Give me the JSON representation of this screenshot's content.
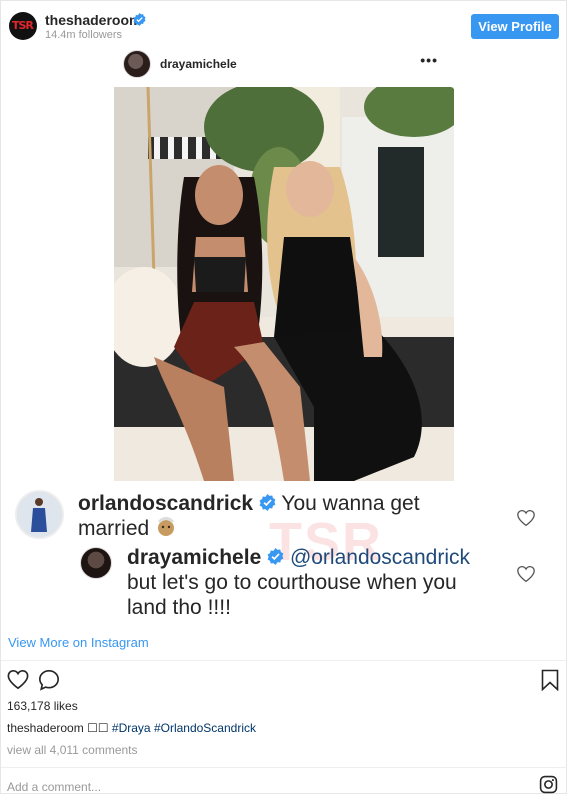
{
  "header": {
    "username": "theshaderoom",
    "followers": "14.4m followers",
    "avatar_text": "TSR",
    "view_profile_label": "View Profile"
  },
  "embed": {
    "username": "drayamichele",
    "more_icon": "more-dots-icon",
    "more_label": "•••"
  },
  "comments": [
    {
      "user": "orlandoscandrick",
      "text_line1": "You wanna get",
      "text_line2": "married"
    },
    {
      "user": "drayamichele",
      "mention": "@orlandoscandrick",
      "text_line1": "but let's go to courthouse when you",
      "text_line2": "land tho !!!!"
    }
  ],
  "watermark": "TSR",
  "view_more_label": "View More on Instagram",
  "likes": "163,178 likes",
  "caption": {
    "user": "theshaderoom",
    "emoji": "☐☐",
    "tags": "#Draya #OrlandoScandrick"
  },
  "view_all_comments": "view all 4,011 comments",
  "add_comment_placeholder": "Add a comment...",
  "colors": {
    "accent": "#3897f0",
    "verified": "#3897f0",
    "tag": "#003569"
  }
}
